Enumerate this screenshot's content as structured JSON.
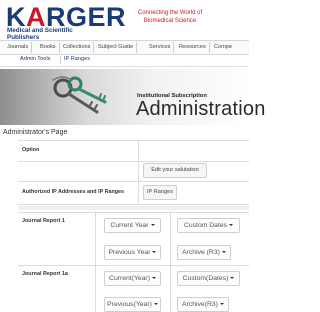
{
  "header": {
    "logo_part1": "K",
    "logo_part2": "ARGER",
    "logo_sub_line1": "Medical and Scientific",
    "logo_sub_line2": "Publishers",
    "tagline_line1": "Connecting the World of",
    "tagline_line2": "Biomedical Science"
  },
  "nav": {
    "items": [
      "Journals",
      "Books",
      "Collections",
      "Subject Guide",
      "Services",
      "Resources",
      "Compe"
    ]
  },
  "subnav": {
    "items": [
      "Admin Tools",
      "IP Ranges"
    ]
  },
  "banner": {
    "subtitle": "Institutional Subscription",
    "title": "Administration"
  },
  "page": {
    "heading": "Administrator's Page"
  },
  "table": {
    "option_header": "Option",
    "ip_label": "Authorized IP Addresses and IP Ranges",
    "edit_salutation_button": "Edit your salutation",
    "ip_ranges_button": "IP Ranges",
    "journal_report_1": "Journal Report 1",
    "journal_report_1a": "Journal Report 1a",
    "jr1": {
      "current_year": "Current Year",
      "custom_dates": "Custom Dates",
      "previous_year": "Previous Year",
      "archive": "Archive (R3)"
    },
    "jr1a": {
      "current_year": "Current(Year)",
      "custom_dates": "Custom(Dates)",
      "previous_year": "Previous(Year)",
      "archive": "Archive(R3)"
    }
  },
  "colors": {
    "brand_blue": "#1a3a78",
    "brand_red": "#c8162b"
  }
}
